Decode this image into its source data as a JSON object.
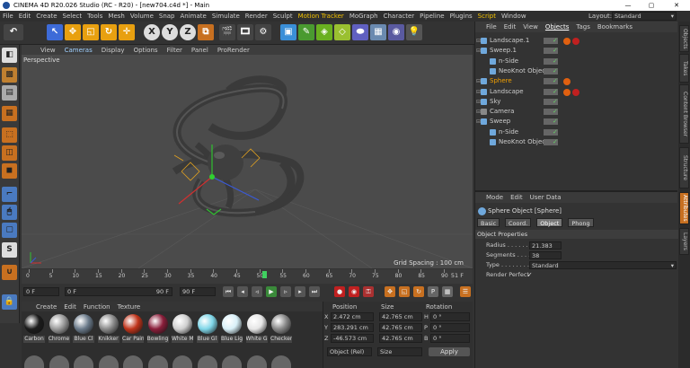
{
  "window": {
    "title": "CINEMA 4D R20.026 Studio (RC - R20) - [new704.c4d *] - Main",
    "minimize": "—",
    "maximize": "▢",
    "close": "✕"
  },
  "menubar": {
    "items": [
      "File",
      "Edit",
      "Create",
      "Select",
      "Tools",
      "Mesh",
      "Volume",
      "Snap",
      "Animate",
      "Simulate",
      "Render",
      "Sculpt",
      "Motion Tracker",
      "MoGraph",
      "Character",
      "Pipeline",
      "Plugins",
      "Script",
      "Window"
    ],
    "highlighted": [
      "Motion Tracker",
      "Script"
    ],
    "layout_label": "Layout:",
    "layout_value": "Standard"
  },
  "toolbar": {
    "x_btn": "X",
    "y_btn": "Y",
    "z_btn": "Z"
  },
  "viewport": {
    "menu": [
      "View",
      "Cameras",
      "Display",
      "Options",
      "Filter",
      "Panel",
      "ProRender"
    ],
    "label": "Perspective",
    "grid_spacing": "Grid Spacing : 100 cm"
  },
  "timeline": {
    "ticks": [
      "0",
      "5",
      "10",
      "15",
      "20",
      "25",
      "30",
      "35",
      "40",
      "45",
      "50",
      "55",
      "60",
      "65",
      "70",
      "75",
      "80",
      "85",
      "90"
    ],
    "current": "51",
    "end_frame": "51 F"
  },
  "playback": {
    "start": "0 F",
    "current": "0 F",
    "max": "90 F",
    "end": "90 F"
  },
  "materials": {
    "menu": [
      "Create",
      "Edit",
      "Function",
      "Texture"
    ],
    "items": [
      {
        "name": "Carbon",
        "color": "#1c1c1c"
      },
      {
        "name": "Chrome",
        "color": "#9a9a9a"
      },
      {
        "name": "Blue Cl",
        "color": "#6a7a8a"
      },
      {
        "name": "Knikker",
        "color": "#8a8a8a"
      },
      {
        "name": "Car Pain",
        "color": "#c0341a"
      },
      {
        "name": "Bowling",
        "color": "#8a1e3a"
      },
      {
        "name": "White M",
        "color": "#cfcfcf"
      },
      {
        "name": "Blue Gl",
        "color": "#7fd6e8"
      },
      {
        "name": "Blue Lig",
        "color": "#d8f0f8"
      },
      {
        "name": "White G",
        "color": "#e6e6e6"
      },
      {
        "name": "Checker",
        "color": "#888888"
      }
    ]
  },
  "coordinates": {
    "headers": {
      "position": "Position",
      "size": "Size",
      "rotation": "Rotation"
    },
    "rows": [
      {
        "axis": "X",
        "pos": "2.472 cm",
        "size": "42.765 cm",
        "rot_axis": "H",
        "rot": "0 °"
      },
      {
        "axis": "Y",
        "pos": "283.291 cm",
        "size": "42.765 cm",
        "rot_axis": "P",
        "rot": "0 °"
      },
      {
        "axis": "Z",
        "pos": "-46.573 cm",
        "size": "42.765 cm",
        "rot_axis": "B",
        "rot": "0 °"
      }
    ],
    "mode": "Object (Rel)",
    "size_mode": "Size",
    "apply": "Apply"
  },
  "objects": {
    "menu": [
      "File",
      "Edit",
      "View",
      "Objects",
      "Tags",
      "Bookmarks"
    ],
    "active_menu": "Objects",
    "rows": [
      {
        "name": "Landscape.1",
        "indent": 0,
        "icon_color": "#6fa8dc",
        "tags": [
          "#e06010",
          "#c02020"
        ],
        "selected": false
      },
      {
        "name": "Sweep.1",
        "indent": 0,
        "icon_color": "#6fa8dc",
        "tags": [],
        "selected": false
      },
      {
        "name": "n-Side",
        "indent": 1,
        "icon_color": "#6fa8dc",
        "tags": [],
        "selected": false
      },
      {
        "name": "NeoKnot Object",
        "indent": 1,
        "icon_color": "#6fa8dc",
        "tags": [],
        "selected": false
      },
      {
        "name": "Sphere",
        "indent": 0,
        "icon_color": "#6fa8dc",
        "tags": [
          "#e06010"
        ],
        "selected": true
      },
      {
        "name": "Landscape",
        "indent": 0,
        "icon_color": "#6fa8dc",
        "tags": [
          "#e06010",
          "#c02020"
        ],
        "selected": false
      },
      {
        "name": "Sky",
        "indent": 0,
        "icon_color": "#6fa8dc",
        "tags": [],
        "selected": false
      },
      {
        "name": "Camera",
        "indent": 0,
        "icon_color": "#888888",
        "tags": [],
        "selected": false
      },
      {
        "name": "Sweep",
        "indent": 0,
        "icon_color": "#6fa8dc",
        "tags": [],
        "selected": false
      },
      {
        "name": "n-Side",
        "indent": 1,
        "icon_color": "#6fa8dc",
        "tags": [],
        "selected": false
      },
      {
        "name": "NeoKnot Object",
        "indent": 1,
        "icon_color": "#6fa8dc",
        "tags": [],
        "selected": false
      }
    ]
  },
  "attributes": {
    "menu": [
      "Mode",
      "Edit",
      "User Data"
    ],
    "title": "Sphere Object [Sphere]",
    "tabs": [
      "Basic",
      "Coord.",
      "Object",
      "Phong"
    ],
    "selected_tab": "Object",
    "section": "Object Properties",
    "radius_label": "Radius . . . . . . .",
    "radius": "21.383 cm",
    "segments_label": "Segments . . . .",
    "segments": "38",
    "type_label": "Type . . . . . . . . .",
    "type": "Standard",
    "render_perfect_label": "Render Perfect",
    "render_perfect_check": "✓"
  },
  "side_tabs": [
    "Objects",
    "Takes",
    "Content Browser",
    "Structure",
    "Attributes",
    "Layers"
  ]
}
